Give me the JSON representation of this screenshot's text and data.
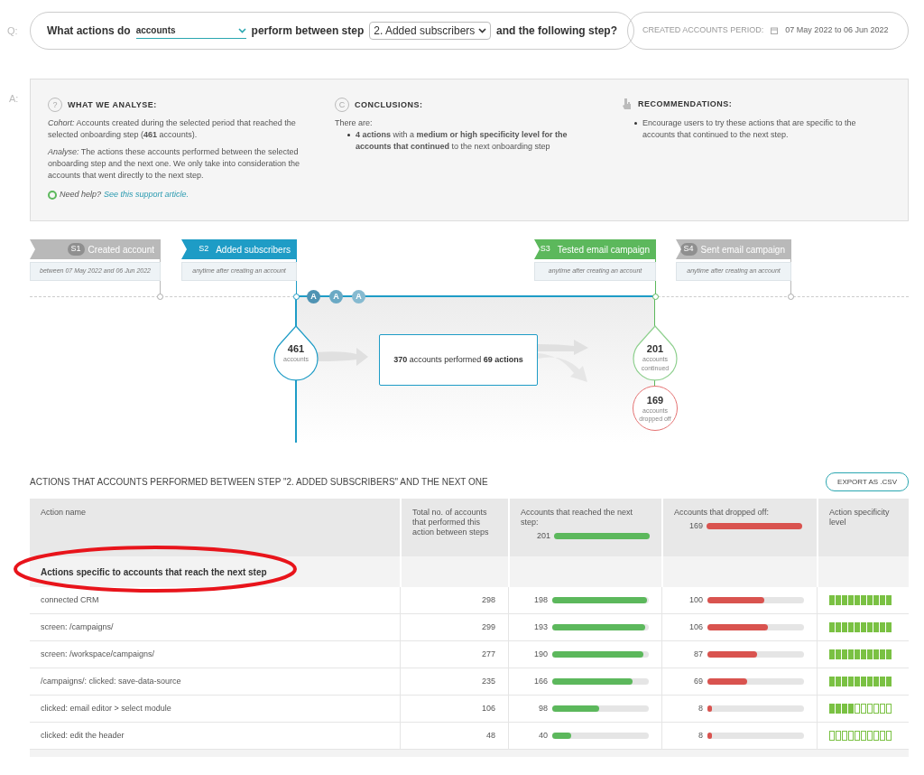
{
  "query": {
    "marker": "Q:",
    "prefix": "What actions do",
    "entity": "accounts",
    "middle": "perform between step",
    "step": "2. Added subscribers",
    "suffix": "and the following step?"
  },
  "period": {
    "label": "CREATED ACCOUNTS PERIOD:",
    "value": "07 May 2022 to 06 Jun 2022"
  },
  "analysis": {
    "marker": "A:",
    "columns": [
      {
        "kind": "question",
        "icon": "?",
        "title": "WHAT WE ANALYSE:",
        "paragraphs": [
          "*Cohort:*  Accounts created during the selected period that reached the selected onboarding step (**461** accounts).",
          "*Analyse:* The actions these accounts performed between the selected onboarding step and the next one. We only take into consideration the accounts that went directly to the next step."
        ],
        "help": {
          "text": "Need help?",
          "link": "See this support article."
        }
      },
      {
        "kind": "conclusion",
        "icon": "C",
        "title": "CONCLUSIONS:",
        "paragraphs": [
          "There are:"
        ],
        "bullets": [
          "**4 actions** with a **medium or high specificity level for the accounts that continued** to the next onboarding step"
        ]
      },
      {
        "kind": "recommendation",
        "title": "RECOMMENDATIONS:",
        "bullets": [
          "Encourage users to try these actions that are specific to the accounts that continued to the next step."
        ]
      }
    ]
  },
  "steps": [
    {
      "badge": "S1",
      "label": "Created account",
      "note": "between 07 May 2022 and 06 Jun 2022",
      "color": "#b9b9b9"
    },
    {
      "badge": "S2",
      "label": "Added subscribers",
      "note": "anytime after creating an account",
      "color": "#1e9cc6"
    },
    {
      "badge": "S3",
      "label": "Tested email campaign",
      "note": "anytime after creating an account",
      "color": "#5cb85c"
    },
    {
      "badge": "S4",
      "label": "Sent email campaign",
      "note": "anytime after creating an account",
      "color": "#b9b9b9"
    }
  ],
  "action_markers": [
    "A",
    "A",
    "A"
  ],
  "flow": {
    "start": {
      "count": "461",
      "label": "accounts"
    },
    "middle": {
      "accounts": "370",
      "text": "accounts performed",
      "actions": "69 actions"
    },
    "continued": {
      "count": "201",
      "label": "accounts continued"
    },
    "dropped": {
      "count": "169",
      "label": "accounts dropped off"
    }
  },
  "table": {
    "title": "ACTIONS THAT ACCOUNTS PERFORMED BETWEEN STEP \"2. ADDED SUBSCRIBERS\" AND THE NEXT ONE",
    "export": "EXPORT AS .CSV",
    "columns": [
      "Action name",
      "Total no. of accounts that performed this action between steps",
      "Accounts that reached the next step:",
      "Accounts that dropped off:",
      "Action specificity level"
    ],
    "reached_total": "201",
    "dropped_total": "169",
    "group": "Actions specific to accounts that reach the next step",
    "rows": [
      {
        "name": "connected CRM",
        "total": "298",
        "reached": {
          "value": "198",
          "level": 0.985
        },
        "dropped": {
          "value": "100",
          "level": 0.59
        },
        "specificity": {
          "stars": 10
        }
      },
      {
        "name": "screen: /campaigns/",
        "total": "299",
        "reached": {
          "value": "193",
          "level": 0.96
        },
        "dropped": {
          "value": "106",
          "level": 0.63
        },
        "specificity": {
          "stars": 10
        }
      },
      {
        "name": "screen: /workspace/campaigns/",
        "total": "277",
        "reached": {
          "value": "190",
          "level": 0.945
        },
        "dropped": {
          "value": "87",
          "level": 0.51
        },
        "specificity": {
          "stars": 10
        }
      },
      {
        "name": "/campaigns/: clicked: save-data-source",
        "total": "235",
        "reached": {
          "value": "166",
          "level": 0.83
        },
        "dropped": {
          "value": "69",
          "level": 0.41
        },
        "specificity": {
          "stars": 10
        }
      },
      {
        "name": "clicked: email editor > select module",
        "total": "106",
        "reached": {
          "value": "98",
          "level": 0.49
        },
        "dropped": {
          "value": "8",
          "level": 0.05
        },
        "specificity": {
          "stars": 4
        }
      },
      {
        "name": "clicked: edit the header",
        "total": "48",
        "reached": {
          "value": "40",
          "level": 0.2
        },
        "dropped": {
          "value": "8",
          "level": 0.05
        },
        "specificity": {
          "stars": 0
        }
      }
    ]
  }
}
